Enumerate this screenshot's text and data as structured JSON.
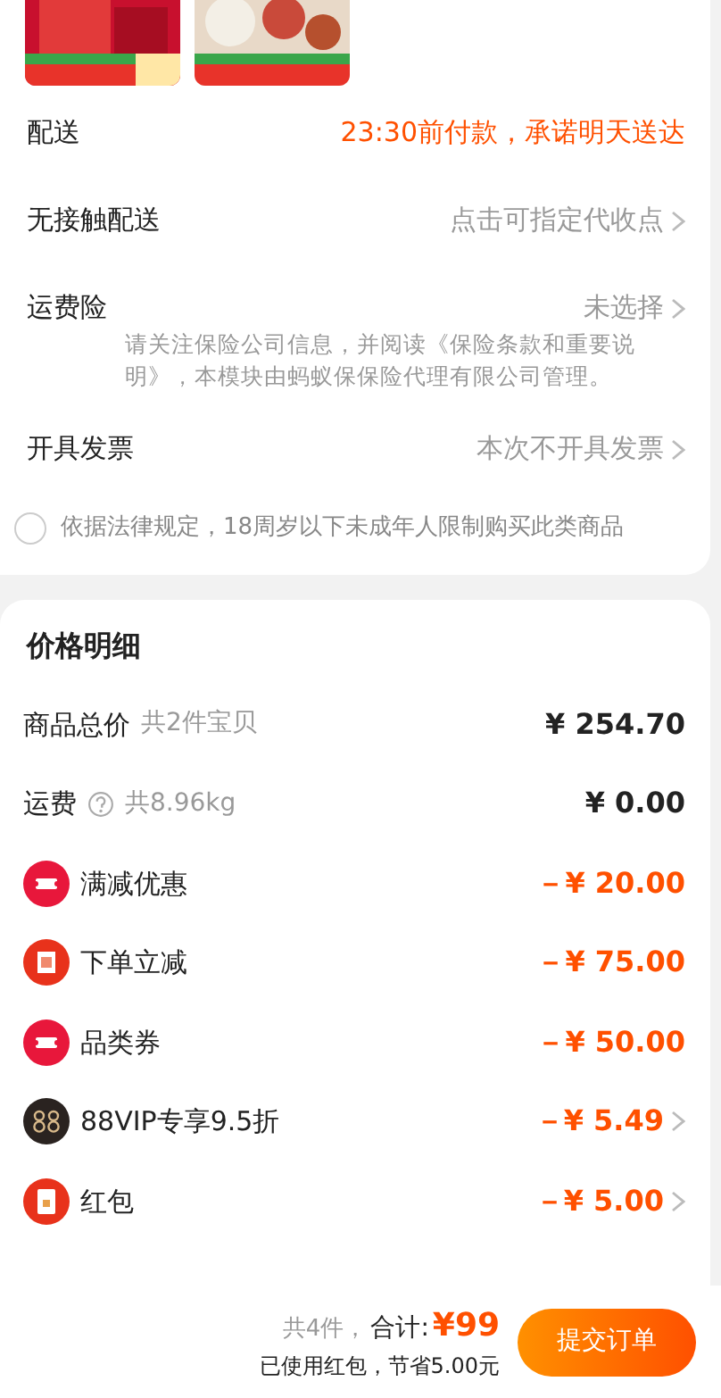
{
  "order_rows": [
    {
      "label": "配送",
      "value": "23:30前付款，承诺明天送达",
      "kind": "highlight",
      "chevron": false
    },
    {
      "label": "无接触配送",
      "value": "点击可指定代收点",
      "kind": "muted",
      "chevron": true
    },
    {
      "label": "运费险",
      "value": "未选择",
      "kind": "muted",
      "chevron": true,
      "note": "请关注保险公司信息，并阅读《保险条款和重要说明》，本模块由蚂蚁保保险代理有限公司管理。"
    },
    {
      "label": "开具发票",
      "value": "本次不开具发票",
      "kind": "muted",
      "chevron": true
    }
  ],
  "age_notice": {
    "text": "依据法律规定，18周岁以下未成年人限制购买此类商品",
    "checked": false
  },
  "price_detail": {
    "title": "价格明细",
    "rows": [
      {
        "label": "商品总价",
        "sub": "共2件宝贝",
        "amount": "¥ 254.70",
        "kind": "plain",
        "chevron": false
      },
      {
        "label": "运费",
        "sub": "共8.96kg",
        "help": true,
        "amount": "¥ 0.00",
        "kind": "plain",
        "chevron": false
      },
      {
        "label": "满减优惠",
        "amount": "－¥ 20.00",
        "kind": "ticket",
        "chevron": false
      },
      {
        "label": "下单立减",
        "amount": "－¥ 75.00",
        "kind": "stamp",
        "chevron": false
      },
      {
        "label": "品类券",
        "amount": "－¥ 50.00",
        "kind": "ticket",
        "chevron": false
      },
      {
        "label": "88VIP专享9.5折",
        "amount": "－¥ 5.49",
        "kind": "vip",
        "chevron": true
      },
      {
        "label": "红包",
        "amount": "－¥ 5.00",
        "kind": "envelope",
        "chevron": true
      }
    ]
  },
  "footer": {
    "count": "共4件，",
    "total_label": "合计:",
    "total": "¥99",
    "savings": "已使用红包，节省5.00元",
    "submit": "提交订单"
  }
}
